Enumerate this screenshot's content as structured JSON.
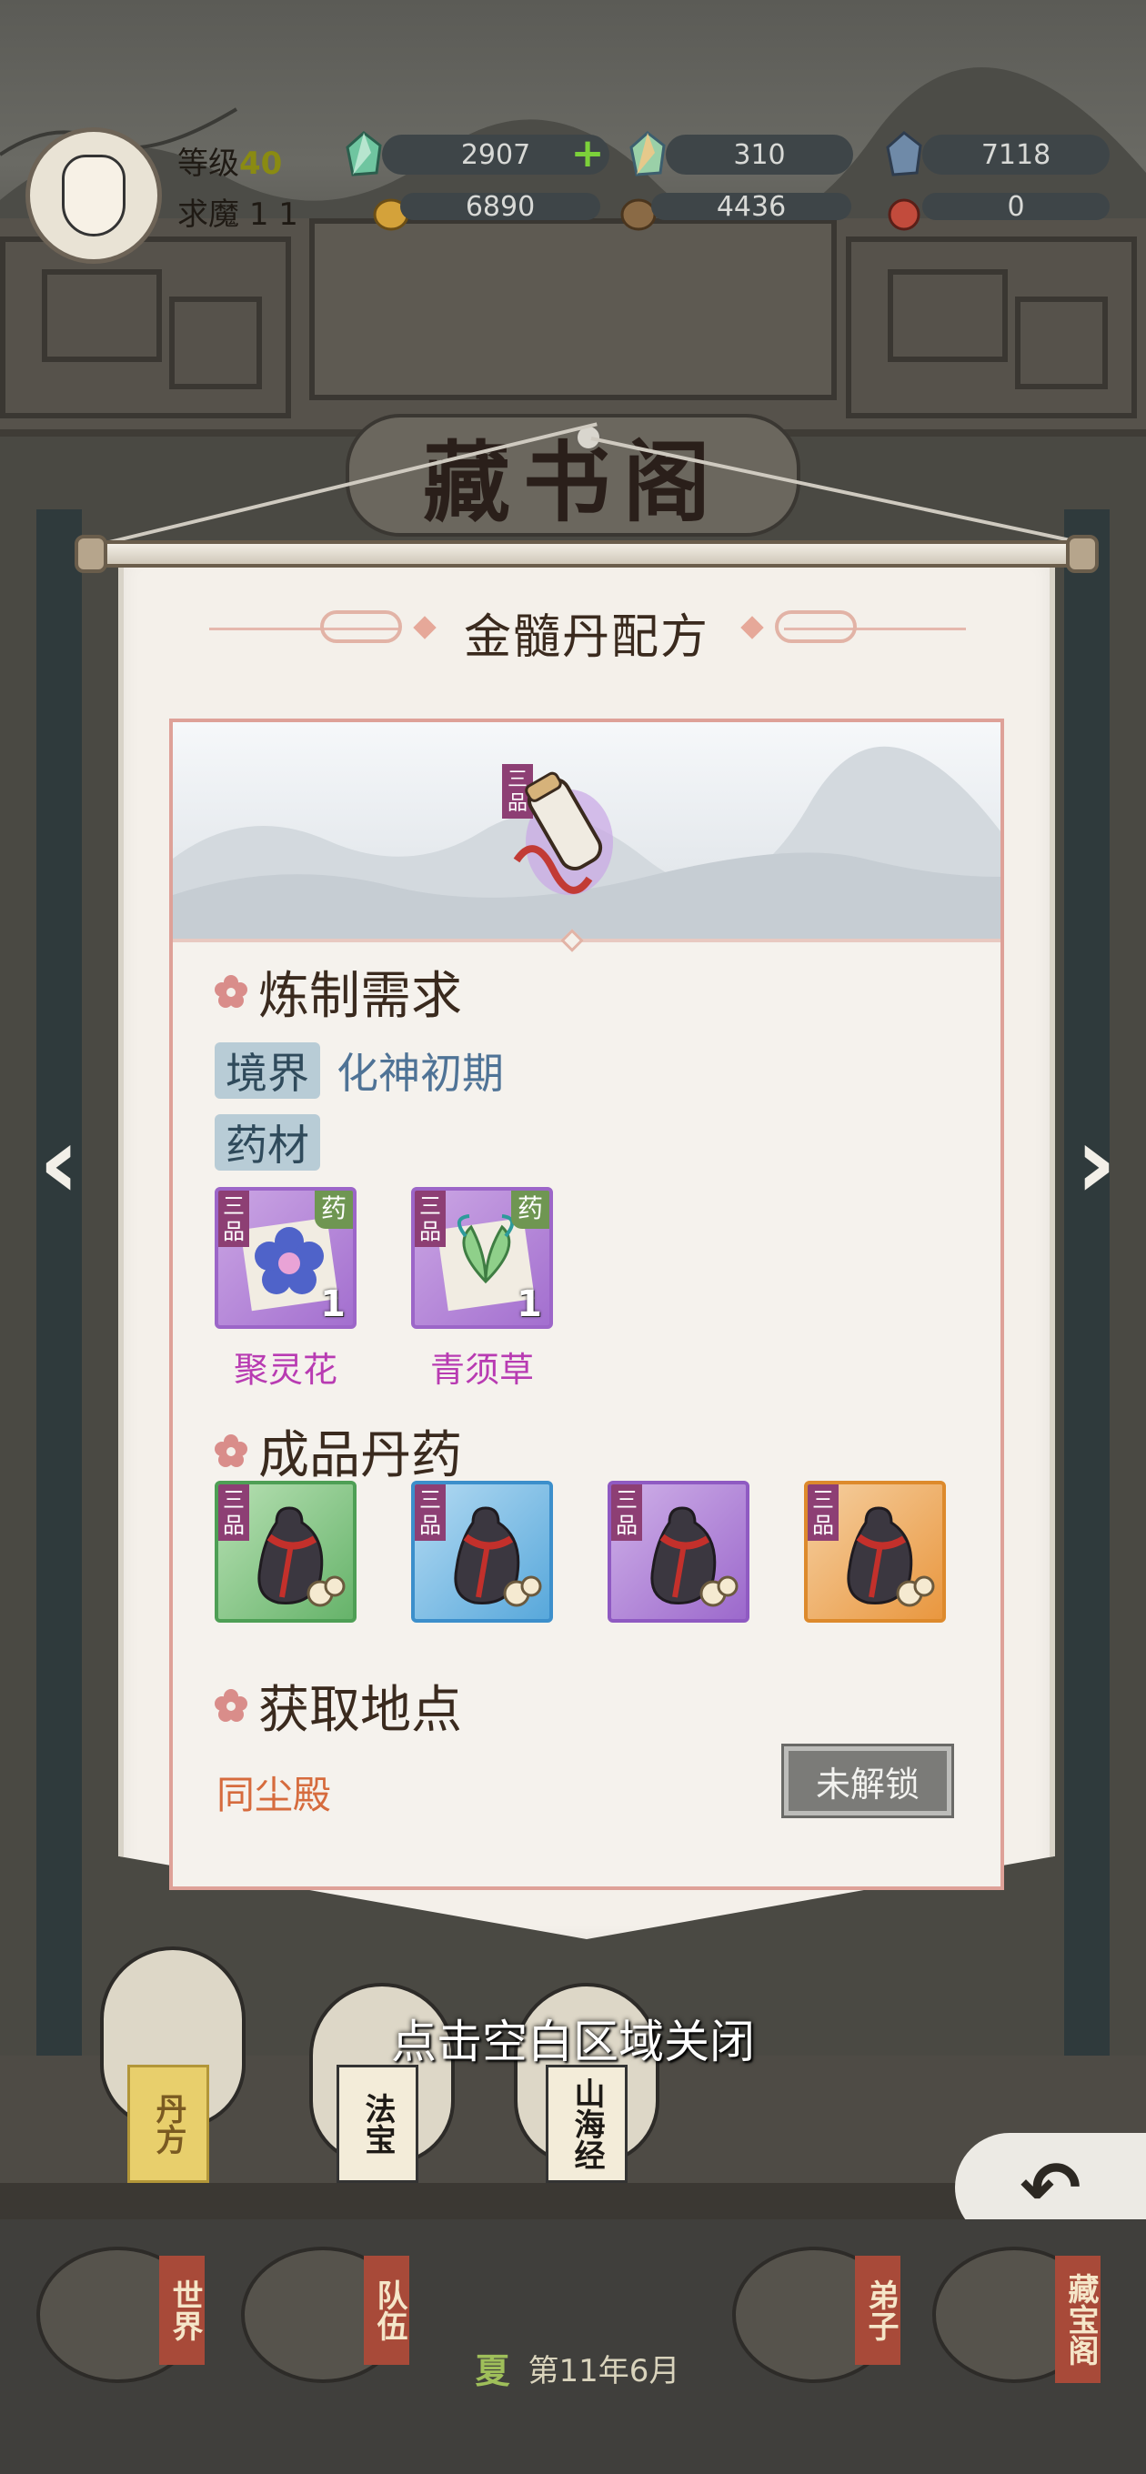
{
  "building_sign": "藏书阁",
  "hud": {
    "level_label": "等级",
    "level_value": "40",
    "seek_label": "求魔",
    "seek_value": "1 1",
    "resources": [
      {
        "icon": "green-spirit-stone-icon",
        "value": "2907",
        "has_plus": true
      },
      {
        "icon": "rainbow-spirit-stone-icon",
        "value": "310",
        "has_plus": false
      },
      {
        "icon": "blue-crystal-icon",
        "value": "7118",
        "has_plus": false
      },
      {
        "icon": "gold-coin-icon",
        "value": "6890",
        "has_plus": false
      },
      {
        "icon": "wood-bag-icon",
        "value": "4436",
        "has_plus": false
      },
      {
        "icon": "red-token-icon",
        "value": "0",
        "has_plus": false
      }
    ]
  },
  "recipe": {
    "title": "金髓丹配方",
    "pill_grade": "三品",
    "requirements_title": "炼制需求",
    "realm_label": "境界",
    "realm_value": "化神初期",
    "materials_label": "药材",
    "materials": [
      {
        "name": "聚灵花",
        "grade": "三品",
        "type": "药",
        "qty": "1",
        "icon": "purple-flower-icon"
      },
      {
        "name": "青须草",
        "grade": "三品",
        "type": "药",
        "qty": "1",
        "icon": "green-herb-icon"
      }
    ],
    "products_title": "成品丹药",
    "products": [
      {
        "grade": "三品",
        "quality": "green",
        "icon": "pill-gourd-icon"
      },
      {
        "grade": "三品",
        "quality": "blue",
        "icon": "pill-gourd-icon"
      },
      {
        "grade": "三品",
        "quality": "purple",
        "icon": "pill-gourd-icon"
      },
      {
        "grade": "三品",
        "quality": "orange",
        "icon": "pill-gourd-icon"
      }
    ],
    "source_title": "获取地点",
    "source_location": "同尘殿",
    "source_status": "未解锁"
  },
  "close_hint": "点击空白区域关闭",
  "scene_tags": {
    "pill": "丹方",
    "treasure": "法宝",
    "classic": "山海经"
  },
  "bottom_nav": [
    {
      "label": "世界"
    },
    {
      "label": "队伍"
    },
    {
      "label": "弟子"
    },
    {
      "label": "藏宝阁"
    }
  ],
  "season": {
    "season": "夏",
    "date": "第11年6月"
  },
  "colors": {
    "accent_title": "#3a2a1e",
    "realm_blue": "#4f7396",
    "material_purple": "#b83bb2",
    "location_orange": "#d66b3d",
    "frame_pink": "#dea198"
  }
}
